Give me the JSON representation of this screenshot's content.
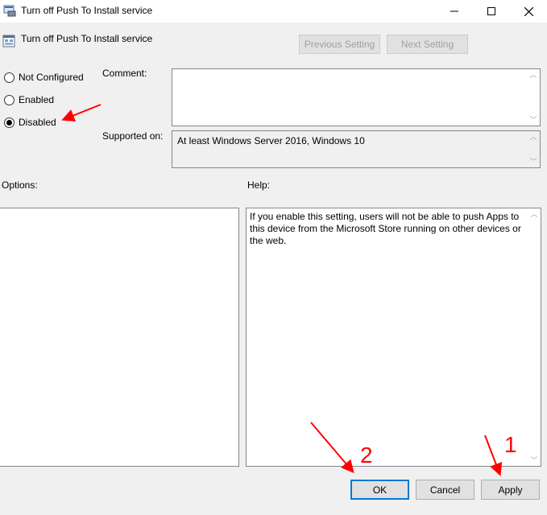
{
  "window": {
    "title": "Turn off Push To Install service",
    "controls": {
      "minimize": "—",
      "maximize": "☐",
      "close": "✕"
    }
  },
  "header": {
    "policy_name": "Turn off Push To Install service",
    "previous_setting": "Previous Setting",
    "next_setting": "Next Setting"
  },
  "state": {
    "options": [
      {
        "label": "Not Configured",
        "checked": false
      },
      {
        "label": "Enabled",
        "checked": false
      },
      {
        "label": "Disabled",
        "checked": true
      }
    ]
  },
  "comment": {
    "label": "Comment:",
    "value": ""
  },
  "supported": {
    "label": "Supported on:",
    "value": "At least Windows Server 2016, Windows 10"
  },
  "options_panel": {
    "label": "Options:"
  },
  "help_panel": {
    "label": "Help:",
    "text": "If you enable this setting, users will not be able to push Apps to this device from the Microsoft Store running on other devices or the web."
  },
  "buttons": {
    "ok": "OK",
    "cancel": "Cancel",
    "apply": "Apply"
  },
  "annotations": {
    "step1": "1",
    "step2": "2",
    "color": "#ff0000"
  }
}
